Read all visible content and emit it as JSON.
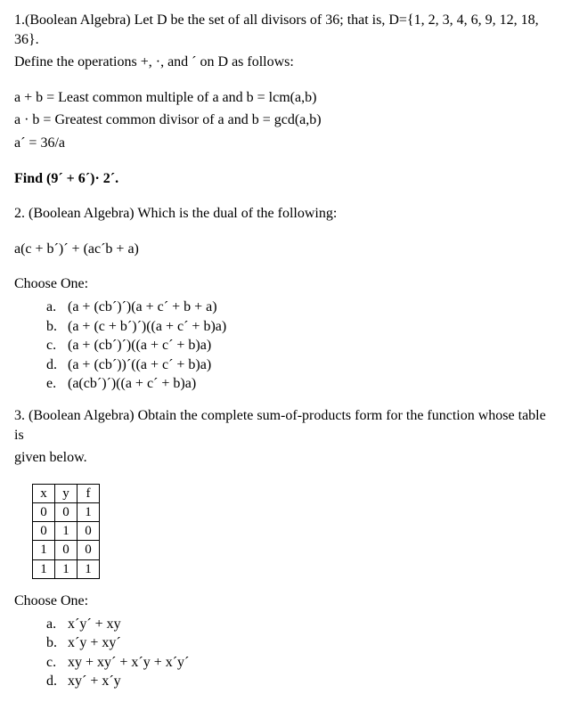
{
  "q1": {
    "line1": "1.(Boolean Algebra) Let D be the set of all divisors of 36; that is, D={1, 2, 3, 4, 6, 9, 12, 18, 36}.",
    "line2": "Define the operations +, ·, and ´ on D as follows:",
    "def1": "a + b = Least common multiple of a and b = lcm(a,b)",
    "def2": "a · b = Greatest common divisor of a and b = gcd(a,b)",
    "def3": "a´ = 36/a",
    "find": "Find (9´ + 6´)· 2´."
  },
  "q2": {
    "line1": "2. (Boolean Algebra) Which is the dual of the following:",
    "expr": "a(c + b´)´ + (ac´b + a)",
    "choose": "Choose One:",
    "choices": {
      "a": {
        "letter": "a.",
        "text": "(a + (cb´)´)(a + c´ + b + a)"
      },
      "b": {
        "letter": "b.",
        "text": "(a + (c + b´)´)((a + c´ + b)a)"
      },
      "c": {
        "letter": "c.",
        "text": "(a + (cb´)´)((a + c´ + b)a)"
      },
      "d": {
        "letter": "d.",
        "text": "(a + (cb´))´((a + c´ + b)a)"
      },
      "e": {
        "letter": "e.",
        "text": "(a(cb´)´)((a + c´ + b)a)"
      }
    }
  },
  "q3": {
    "line1": "3. (Boolean Algebra) Obtain the complete sum-of-products form for the function whose table is",
    "line2": "given below.",
    "table": {
      "h1": "x",
      "h2": "y",
      "h3": "f",
      "r1c1": "0",
      "r1c2": "0",
      "r1c3": "1",
      "r2c1": "0",
      "r2c2": "1",
      "r2c3": "0",
      "r3c1": "1",
      "r3c2": "0",
      "r3c3": "0",
      "r4c1": "1",
      "r4c2": "1",
      "r4c3": "1"
    },
    "choose": "Choose One:",
    "choices": {
      "a": {
        "letter": "a.",
        "text": "x´y´ + xy"
      },
      "b": {
        "letter": "b.",
        "text": "x´y + xy´"
      },
      "c": {
        "letter": "c.",
        "text": "xy + xy´ + x´y + x´y´"
      },
      "d": {
        "letter": "d.",
        "text": "xy´ + x´y"
      }
    }
  }
}
